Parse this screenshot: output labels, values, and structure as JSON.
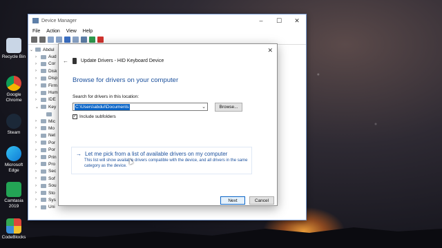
{
  "desktop": {
    "icons": [
      {
        "label": "Recycle Bin",
        "color": "#c9d6e6"
      },
      {
        "label": "Google Chrome",
        "color": "#db4437"
      },
      {
        "label": "Steam",
        "color": "#1b2838"
      },
      {
        "label": "Microsoft Edge",
        "color": "#0f7bd6"
      },
      {
        "label": "Camtasia 2019",
        "color": "#23a455"
      },
      {
        "label": "CodeBlocks",
        "color": "#e0463a"
      }
    ]
  },
  "device_manager": {
    "title": "Device Manager",
    "menu": [
      "File",
      "Action",
      "View",
      "Help"
    ],
    "tree": [
      {
        "label": "Abdul",
        "arrow": "⌄"
      },
      {
        "label": "Aud",
        "arrow": "›"
      },
      {
        "label": "Cor",
        "arrow": "›"
      },
      {
        "label": "Disk",
        "arrow": "›"
      },
      {
        "label": "Disp",
        "arrow": "›"
      },
      {
        "label": "Firm",
        "arrow": "›"
      },
      {
        "label": "Hum",
        "arrow": "›"
      },
      {
        "label": "IDE",
        "arrow": "›"
      },
      {
        "label": "Key",
        "arrow": "⌄"
      },
      {
        "label": "",
        "arrow": ""
      },
      {
        "label": "Mic",
        "arrow": "›"
      },
      {
        "label": "Mo",
        "arrow": "›"
      },
      {
        "label": "Net",
        "arrow": "›"
      },
      {
        "label": "Por",
        "arrow": "›"
      },
      {
        "label": "Por",
        "arrow": "›"
      },
      {
        "label": "Prin",
        "arrow": "›"
      },
      {
        "label": "Pro",
        "arrow": "›"
      },
      {
        "label": "Sec",
        "arrow": "›"
      },
      {
        "label": "Sof",
        "arrow": "›"
      },
      {
        "label": "Sou",
        "arrow": "›"
      },
      {
        "label": "Sto",
        "arrow": "›"
      },
      {
        "label": "Sys",
        "arrow": "›"
      },
      {
        "label": "Uni",
        "arrow": "›"
      }
    ]
  },
  "dialog": {
    "header": "Update Drivers - HID Keyboard Device",
    "heading": "Browse for drivers on your computer",
    "search_label": "Search for drivers in this location:",
    "path_value": "C:\\Users\\abdul\\Documents",
    "browse_label": "Browse...",
    "include_subfolders": "Include subfolders",
    "pick_title": "Let me pick from a list of available drivers on my computer",
    "pick_desc": "This list will show available drivers compatible with the device, and all drivers in the same category as the device.",
    "next_label": "Next",
    "cancel_label": "Cancel"
  }
}
